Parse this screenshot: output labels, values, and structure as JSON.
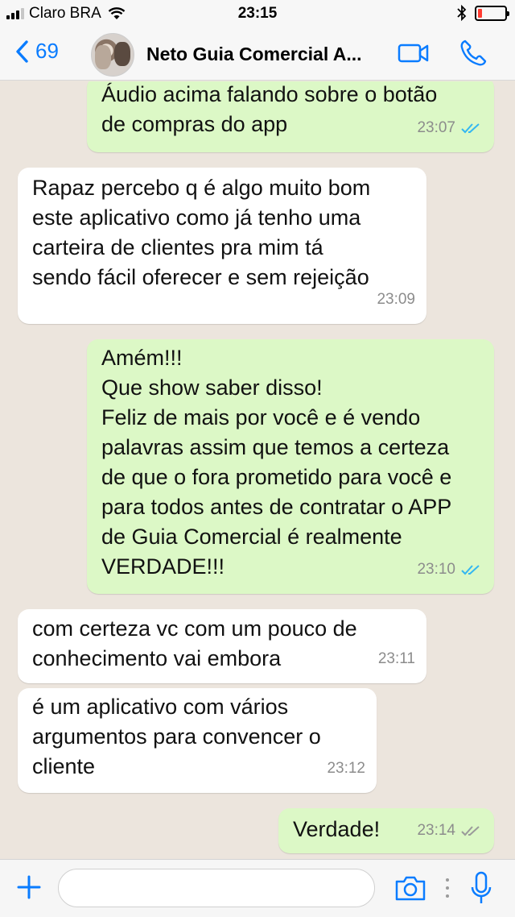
{
  "status_bar": {
    "carrier": "Claro BRA",
    "time": "23:15",
    "battery_level": 0.15,
    "battery_color": "#ff3b30"
  },
  "header": {
    "back_count": "69",
    "contact_name": "Neto Guia Comercial A...",
    "accent_color": "#0a7cff",
    "icons": [
      "chevron-left-icon",
      "video-call-icon",
      "phone-icon"
    ]
  },
  "messages": [
    {
      "direction": "out",
      "text": "Áudio acima falando sobre o botão\nde compras do app",
      "time": "23:07",
      "status": "read"
    },
    {
      "direction": "in",
      "text": "Rapaz percebo q é algo muito bom\neste aplicativo como já tenho uma\ncarteira de clientes pra mim tá\nsendo fácil oferecer e sem rejeição",
      "time": "23:09"
    },
    {
      "direction": "out",
      "text": "Amém!!!\nQue show saber disso!\nFeliz de mais por você e é vendo\npalavras assim que temos a certeza\nde que o fora prometido para você e\npara todos antes de contratar o APP\nde Guia Comercial é realmente\nVERDADE!!!",
      "time": "23:10",
      "status": "read"
    },
    {
      "direction": "in",
      "text": "com certeza vc com um pouco de\nconhecimento vai embora",
      "time": "23:11"
    },
    {
      "direction": "in",
      "text": "é um aplicativo com vários\nargumentos para convencer o\ncliente",
      "time": "23:12"
    },
    {
      "direction": "out",
      "text": "Verdade!",
      "time": "23:14",
      "status": "delivered"
    }
  ],
  "colors": {
    "outgoing_bubble": "#dcf8c6",
    "incoming_bubble": "#ffffff",
    "chat_background": "#ece5dd",
    "read_ticks": "#34b7f1",
    "delivered_ticks": "#9a9a9a"
  },
  "input_bar": {
    "placeholder": "",
    "icons": [
      "plus-icon",
      "camera-icon",
      "mic-icon"
    ]
  }
}
